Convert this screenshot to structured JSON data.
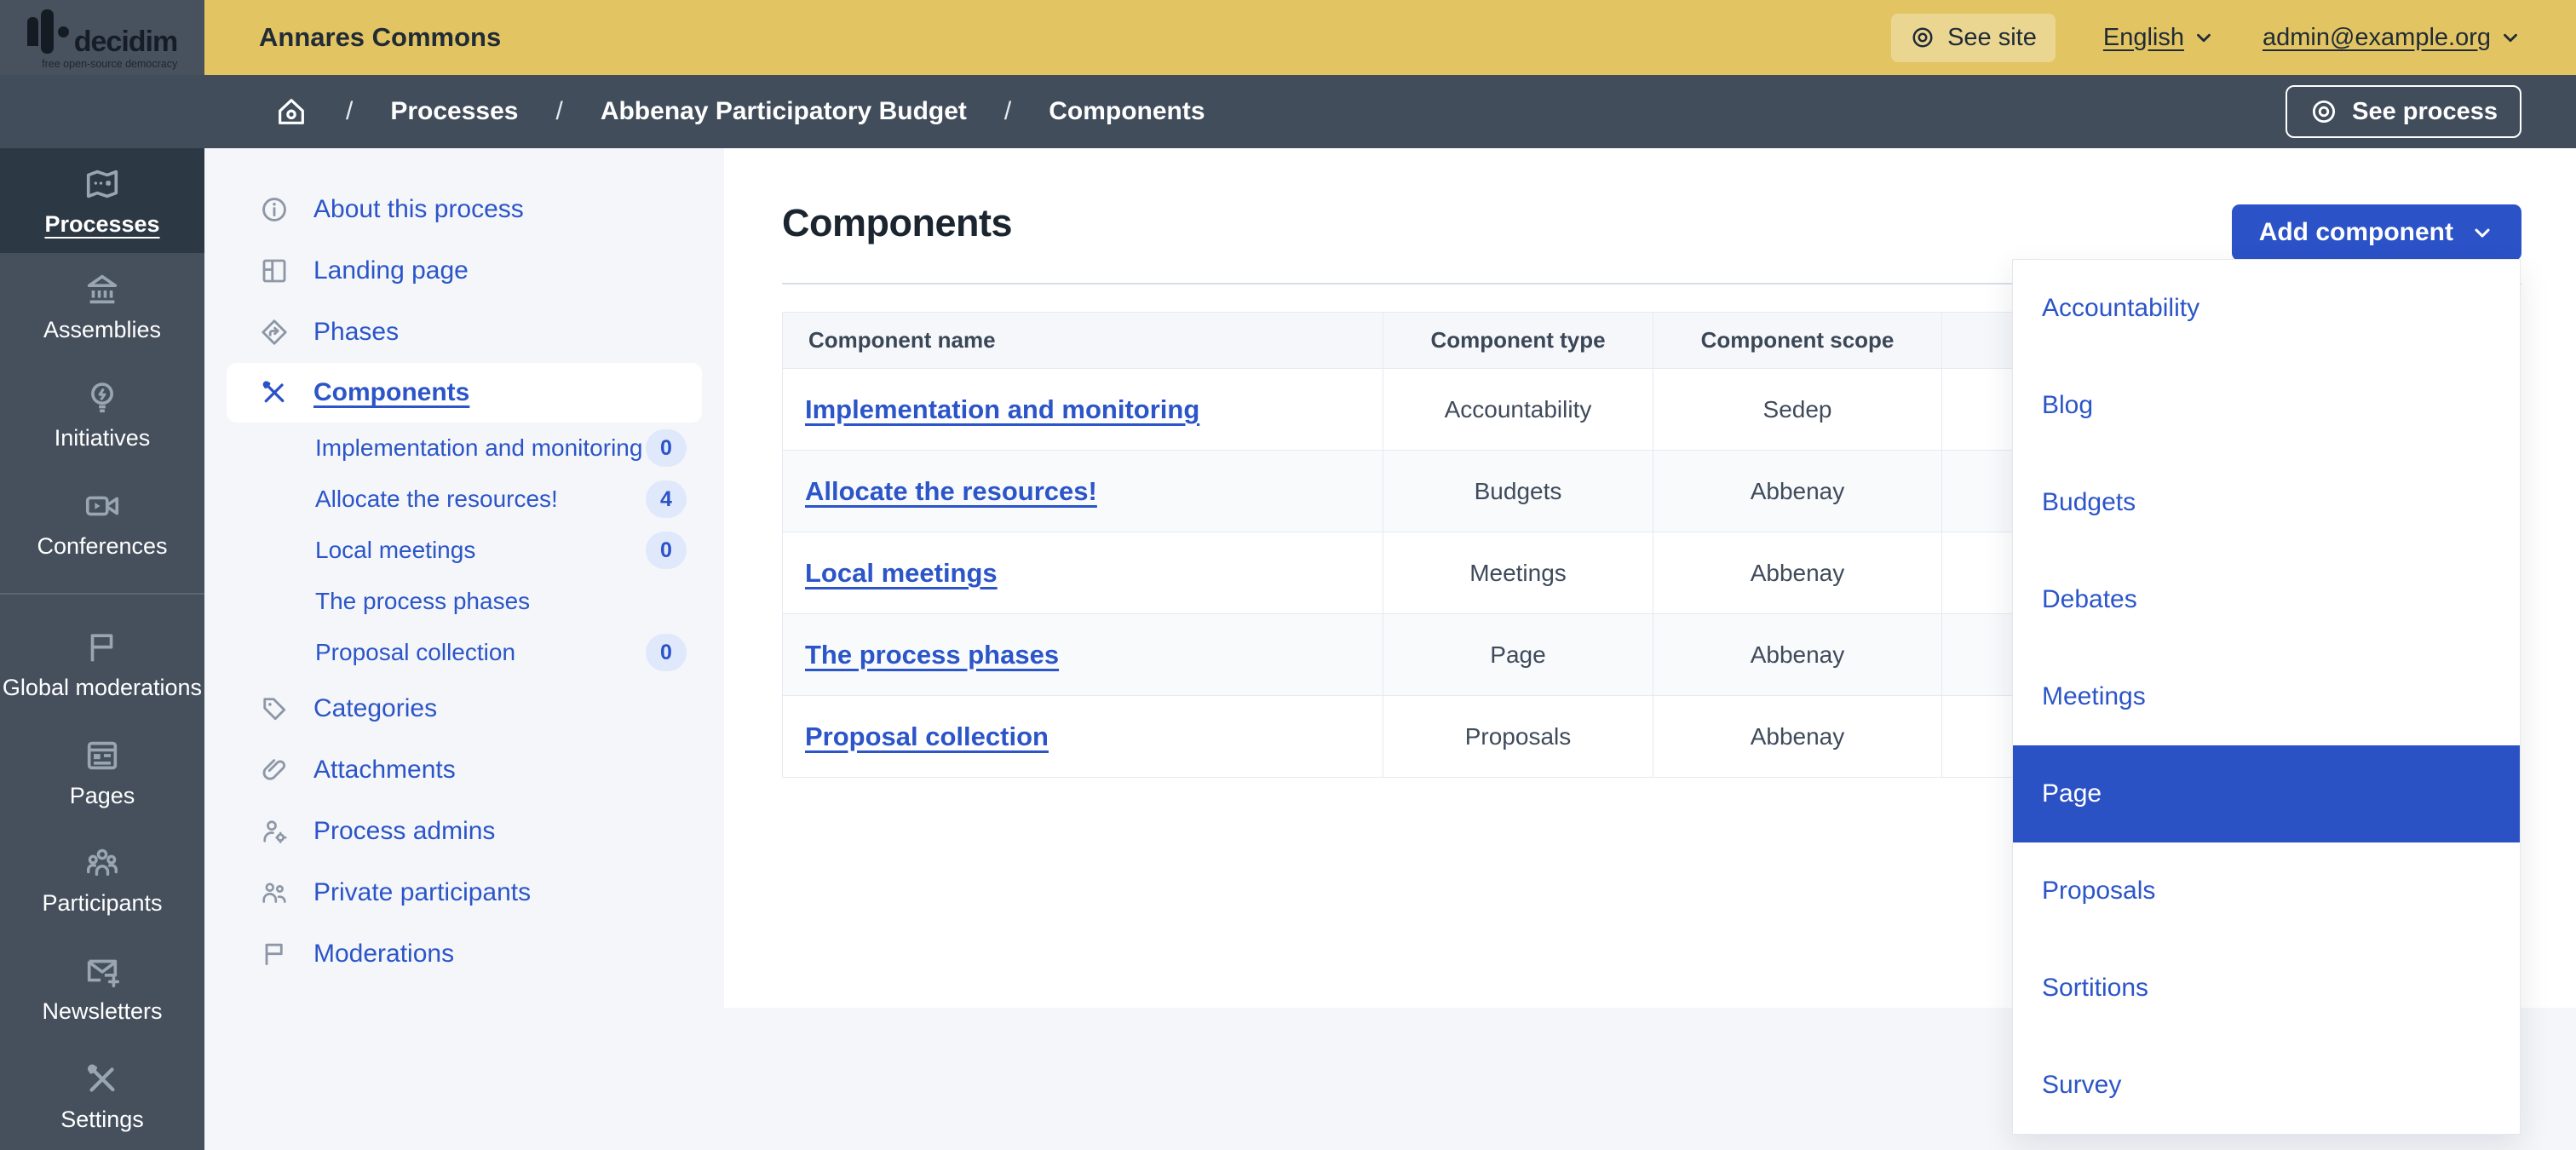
{
  "colors": {
    "accent_blue": "#2b52c8",
    "header_gold": "#e2c462",
    "slate": "#46505d",
    "slate_active": "#2c3844",
    "menu_bg": "#f4f6fa",
    "badge_bg": "#dfe9fb",
    "table_border": "#e5e9f0",
    "table_header_bg": "#f5f7fb",
    "row_alt_bg": "#f8fafc"
  },
  "topbar": {
    "brand": "decidim",
    "brand_tagline": "free open-source democracy",
    "org_name": "Annares Commons",
    "see_site_label": "See site",
    "language_label": "English",
    "account_label": "admin@example.org"
  },
  "breadcrumb": {
    "separator": "/",
    "items": [
      "Processes",
      "Abbenay Participatory Budget",
      "Components"
    ],
    "see_process_label": "See process"
  },
  "sidebar": {
    "items": [
      {
        "label": "Processes",
        "icon": "map-icon",
        "active": true
      },
      {
        "label": "Assemblies",
        "icon": "assembly-building-icon",
        "active": false
      },
      {
        "label": "Initiatives",
        "icon": "lightbulb-icon",
        "active": false
      },
      {
        "label": "Conferences",
        "icon": "video-camera-icon",
        "active": false
      },
      {
        "label": "Global moderations",
        "icon": "flag-icon",
        "active": false
      },
      {
        "label": "Pages",
        "icon": "page-layout-icon",
        "active": false
      },
      {
        "label": "Participants",
        "icon": "people-group-icon",
        "active": false
      },
      {
        "label": "Newsletters",
        "icon": "mail-add-icon",
        "active": false
      },
      {
        "label": "Settings",
        "icon": "tools-icon",
        "active": false
      }
    ]
  },
  "process_menu": {
    "items": [
      {
        "label": "About this process",
        "icon": "info-icon"
      },
      {
        "label": "Landing page",
        "icon": "layout-grid-icon"
      },
      {
        "label": "Phases",
        "icon": "phases-diamond-icon"
      },
      {
        "label": "Components",
        "icon": "tools-icon",
        "active": true
      }
    ],
    "component_children": [
      {
        "label": "Implementation and monitoring",
        "count": "0"
      },
      {
        "label": "Allocate the resources!",
        "count": "4"
      },
      {
        "label": "Local meetings",
        "count": "0"
      },
      {
        "label": "The process phases",
        "count": null
      },
      {
        "label": "Proposal collection",
        "count": "0"
      }
    ],
    "items_after": [
      {
        "label": "Categories",
        "icon": "tag-icon"
      },
      {
        "label": "Attachments",
        "icon": "paperclip-icon"
      },
      {
        "label": "Process admins",
        "icon": "user-gear-icon"
      },
      {
        "label": "Private participants",
        "icon": "two-users-icon"
      },
      {
        "label": "Moderations",
        "icon": "flag-icon"
      }
    ]
  },
  "main": {
    "title": "Components",
    "add_component_label": "Add component",
    "table": {
      "headers": [
        "Component name",
        "Component type",
        "Component scope",
        ""
      ],
      "rows": [
        {
          "name": "Implementation and monitoring",
          "type": "Accountability",
          "scope": "Sedep"
        },
        {
          "name": "Allocate the resources!",
          "type": "Budgets",
          "scope": "Abbenay"
        },
        {
          "name": "Local meetings",
          "type": "Meetings",
          "scope": "Abbenay"
        },
        {
          "name": "The process phases",
          "type": "Page",
          "scope": "Abbenay"
        },
        {
          "name": "Proposal collection",
          "type": "Proposals",
          "scope": "Abbenay"
        }
      ]
    }
  },
  "add_component_menu": {
    "options": [
      {
        "label": "Accountability",
        "active": false
      },
      {
        "label": "Blog",
        "active": false
      },
      {
        "label": "Budgets",
        "active": false
      },
      {
        "label": "Debates",
        "active": false
      },
      {
        "label": "Meetings",
        "active": false
      },
      {
        "label": "Page",
        "active": true
      },
      {
        "label": "Proposals",
        "active": false
      },
      {
        "label": "Sortitions",
        "active": false
      },
      {
        "label": "Survey",
        "active": false
      }
    ]
  }
}
